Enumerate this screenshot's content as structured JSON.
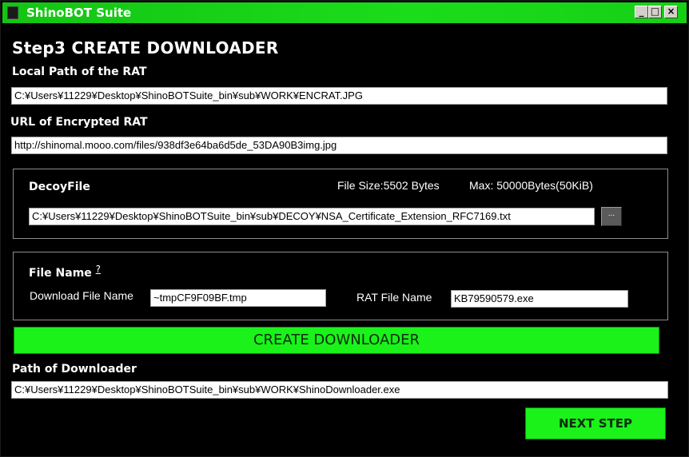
{
  "window": {
    "title": "ShinoBOT Suite",
    "minimize": "_",
    "maximize": "□",
    "close": "×"
  },
  "step_title": "Step3   CREATE DOWNLOADER",
  "local_path": {
    "label": "Local Path of the RAT",
    "value": "C:¥Users¥11229¥Desktop¥ShinoBOTSuite_bin¥sub¥WORK¥ENCRAT.JPG"
  },
  "url": {
    "label": "URL of Encrypted RAT",
    "value": "http://shinomal.mooo.com/files/938df3e64ba6d5de_53DA90B3img.jpg"
  },
  "decoy": {
    "label": "DecoyFile",
    "file_size": "File Size:5502 Bytes",
    "max": "Max: 50000Bytes(50KiB)",
    "value": "C:¥Users¥11229¥Desktop¥ShinoBOTSuite_bin¥sub¥DECOY¥NSA_Certificate_Extension_RFC7169.txt",
    "browse": "..."
  },
  "file_name": {
    "label": "File Name",
    "help": "?",
    "download_label": "Download File Name",
    "download_value": "~tmpCF9F09BF.tmp",
    "rat_label": "RAT File Name",
    "rat_value": "KB79590579.exe"
  },
  "create_button": "CREATE DOWNLOADER",
  "downloader_path": {
    "label": "Path of Downloader",
    "value": "C:¥Users¥11229¥Desktop¥ShinoBOTSuite_bin¥sub¥WORK¥ShinoDownloader.exe"
  },
  "next_button": "NEXT STEP",
  "colors": {
    "accent": "#1af21a",
    "titlebar": "#18d018",
    "background": "#000000",
    "text": "#ffffff"
  }
}
